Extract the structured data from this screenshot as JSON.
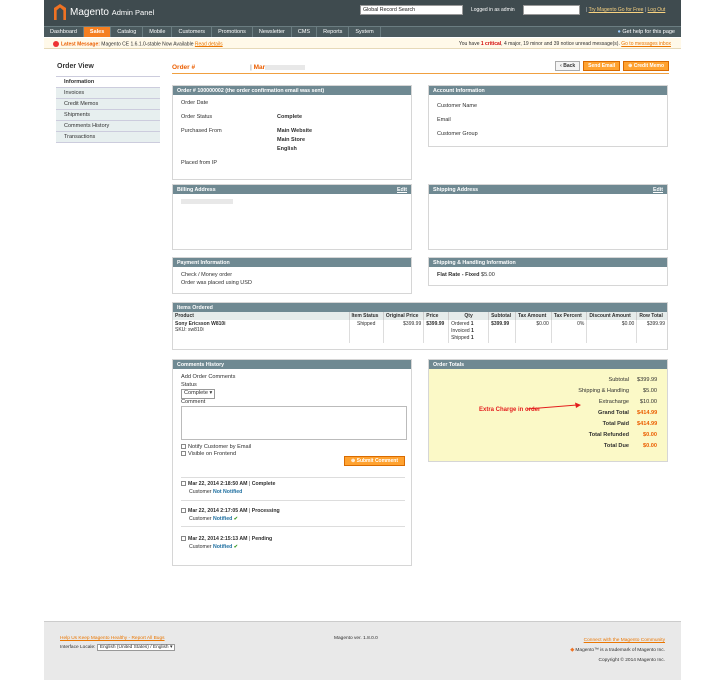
{
  "header": {
    "app_title": "Magento",
    "app_subtitle": "Admin Panel",
    "search_value": "Global Record Search",
    "logged_in": "Logged in as admin",
    "link_try": "Try Magento Go for Free",
    "link_logout": "Log Out"
  },
  "nav": {
    "items": [
      "Dashboard",
      "Sales",
      "Catalog",
      "Mobile",
      "Customers",
      "Promotions",
      "Newsletter",
      "CMS",
      "Reports",
      "System"
    ],
    "active": "Sales",
    "help": "Get help for this page"
  },
  "message": {
    "label": "Latest Message:",
    "text": "Magento CE 1.6.1.0-stable Now Available",
    "read": "Read details",
    "right_prefix": "You have",
    "critical": "1 critical",
    "rest": ", 4 major, 19 minor and 39 notice unread message(s).",
    "goto": "Go to messages inbox"
  },
  "sidebar": {
    "title": "Order View",
    "items": [
      "Information",
      "Invoices",
      "Credit Memos",
      "Shipments",
      "Comments History",
      "Transactions"
    ]
  },
  "title": {
    "order": "Order #",
    "name": "Mar",
    "back": "Back",
    "send_email": "Send Email",
    "credit_memo": "Credit Memo"
  },
  "order_info": {
    "heading": "Order # 100000002 (the order confirmation email was sent)",
    "rows": [
      {
        "k": "Order Date",
        "v": ""
      },
      {
        "k": "Order Status",
        "v": "Complete"
      },
      {
        "k": "Purchased From",
        "v": "Main Website"
      },
      {
        "k": "",
        "v": "Main Store"
      },
      {
        "k": "",
        "v": "English"
      }
    ],
    "placed_ip": "Placed from IP"
  },
  "account": {
    "heading": "Account Information",
    "rows": [
      "Customer Name",
      "Email",
      "Customer Group"
    ]
  },
  "billing": {
    "heading": "Billing Address",
    "edit": "Edit"
  },
  "shipping": {
    "heading": "Shipping Address",
    "edit": "Edit"
  },
  "payment": {
    "heading": "Payment Information",
    "line1": "Check / Money order",
    "line2": "Order was placed using USD"
  },
  "ship_handling": {
    "heading": "Shipping & Handling Information",
    "method": "Flat Rate - Fixed",
    "price": "$5.00"
  },
  "items": {
    "heading": "Items Ordered",
    "columns": [
      "Product",
      "Item Status",
      "Original Price",
      "Price",
      "Qty",
      "Subtotal",
      "Tax Amount",
      "Tax Percent",
      "Discount Amount",
      "Row Total"
    ],
    "rows": [
      {
        "product": "Sony Ericsson W810i",
        "sku": "SKU: sw810i",
        "status": "Shipped",
        "original": "$399.99",
        "price": "$399.99",
        "qty_ordered": "Ordered",
        "qty_ordered_n": "1",
        "qty_invoiced": "Invoiced",
        "qty_invoiced_n": "1",
        "qty_shipped": "Shipped",
        "qty_shipped_n": "1",
        "subtotal": "$399.99",
        "tax": "$0.00",
        "tax_pct": "0%",
        "discount": "$0.00",
        "row_total": "$399.99"
      }
    ]
  },
  "comments": {
    "heading": "Comments History",
    "add": "Add Order Comments",
    "status_label": "Status",
    "status_value": "Complete",
    "comment_label": "Comment",
    "notify": "Notify Customer by Email",
    "visible": "Visible on Frontend",
    "submit": "Submit Comment",
    "history": [
      {
        "date": "Mar 22, 2014 2:18:50 AM",
        "status": "Complete",
        "note": "Customer",
        "state": "Not Notified",
        "check": ""
      },
      {
        "date": "Mar 22, 2014 2:17:05 AM",
        "status": "Processing",
        "note": "Customer",
        "state": "Notified",
        "check": "✔"
      },
      {
        "date": "Mar 22, 2014 2:15:13 AM",
        "status": "Pending",
        "note": "Customer",
        "state": "Notified",
        "check": "✔"
      }
    ]
  },
  "totals": {
    "heading": "Order Totals",
    "extra_label": "Extra Charge in order",
    "rows": [
      {
        "l": "Subtotal",
        "v": "$399.99"
      },
      {
        "l": "Shipping & Handling",
        "v": "$5.00"
      },
      {
        "l": "Extracharge",
        "v": "$10.00"
      },
      {
        "l": "Grand Total",
        "v": "$414.99"
      },
      {
        "l": "Total Paid",
        "v": "$414.99"
      },
      {
        "l": "Total Refunded",
        "v": "$0.00"
      },
      {
        "l": "Total Due",
        "v": "$0.00"
      }
    ]
  },
  "footer": {
    "help_link": "Help Us Keep Magento Healthy - Report All Bugs",
    "locale_label": "Interface Locale:",
    "locale_value": "English (United States) / English",
    "version": "Magento ver. 1.8.0.0",
    "community": "Connect with the Magento Community",
    "trademark": "Magento™ is a trademark of Magento Inc.",
    "copyright": "Copyright © 2014 Magento Inc."
  },
  "colors": {
    "accent": "#f57f21",
    "header": "#3f4b4f",
    "box_head": "#6f8992",
    "totals_bg": "#fbf9c7",
    "extra_red": "#e41e1e"
  }
}
